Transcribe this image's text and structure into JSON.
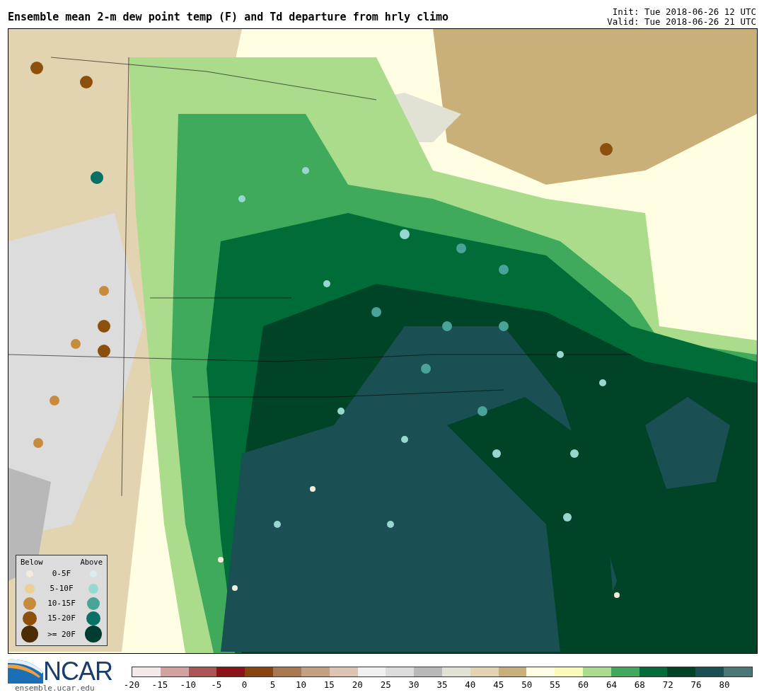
{
  "title": "Ensemble mean 2-m dew point temp (F) and Td departure from hrly climo",
  "init": "Init: Tue 2018-06-26 12 UTC",
  "valid": "Valid: Tue 2018-06-26 21 UTC",
  "legend": {
    "below_heading": "Below",
    "above_heading": "Above",
    "rows": [
      {
        "label": "0-5F",
        "below": {
          "color": "#f3ecdc"
        },
        "above": {
          "color": "#d8eeec"
        }
      },
      {
        "label": "5-10F",
        "below": {
          "color": "#ead096"
        },
        "above": {
          "color": "#96d8d0"
        }
      },
      {
        "label": "10-15F",
        "below": {
          "color": "#c68c3c"
        },
        "above": {
          "color": "#48a498"
        }
      },
      {
        "label": "15-20F",
        "below": {
          "color": "#8c500c"
        },
        "above": {
          "color": "#087064"
        }
      },
      {
        "label": ">= 20F",
        "below": {
          "color": "#4c2c04"
        },
        "above": {
          "color": "#003c30"
        }
      }
    ]
  },
  "logo": {
    "name": "NCAR",
    "url": "ensemble.ucar.edu"
  },
  "colorbar": [
    {
      "label": "-20",
      "color": "#f5e8e8"
    },
    {
      "label": "-15",
      "color": "#d4a0a0"
    },
    {
      "label": "-10",
      "color": "#aa5454"
    },
    {
      "label": "-5",
      "color": "#8c1418"
    },
    {
      "label": "0",
      "color": "#8a4410"
    },
    {
      "label": "5",
      "color": "#a87850"
    },
    {
      "label": "10",
      "color": "#c4a080"
    },
    {
      "label": "15",
      "color": "#dec4b0"
    },
    {
      "label": "20",
      "color": "#f0f0f0"
    },
    {
      "label": "25",
      "color": "#dcdcdc"
    },
    {
      "label": "30",
      "color": "#b8b8b8"
    },
    {
      "label": "35",
      "color": "#e2e2d4"
    },
    {
      "label": "40",
      "color": "#e2d4b0"
    },
    {
      "label": "45",
      "color": "#c8b078"
    },
    {
      "label": "50",
      "color": "#fffee2"
    },
    {
      "label": "55",
      "color": "#f8fcb8"
    },
    {
      "label": "60",
      "color": "#aadc8c"
    },
    {
      "label": "64",
      "color": "#40aa5c"
    },
    {
      "label": "68",
      "color": "#006c38"
    },
    {
      "label": "72",
      "color": "#004428"
    },
    {
      "label": "76",
      "color": "#1a5054"
    },
    {
      "label": "80",
      "color": "#4a7678"
    }
  ]
}
